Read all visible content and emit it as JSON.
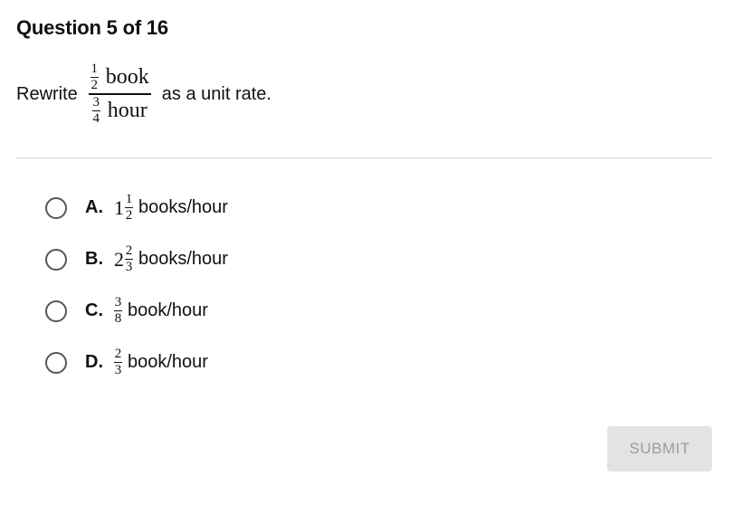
{
  "header": {
    "title": "Question 5 of 16"
  },
  "question": {
    "prefix": "Rewrite",
    "suffix": "as a unit rate.",
    "numerator": {
      "num": "1",
      "den": "2",
      "unit": "book"
    },
    "denominator": {
      "num": "3",
      "den": "4",
      "unit": "hour"
    }
  },
  "options": [
    {
      "letter": "A.",
      "whole": "1",
      "num": "1",
      "den": "2",
      "unit": "books/hour"
    },
    {
      "letter": "B.",
      "whole": "2",
      "num": "2",
      "den": "3",
      "unit": "books/hour"
    },
    {
      "letter": "C.",
      "whole": "",
      "num": "3",
      "den": "8",
      "unit": "book/hour"
    },
    {
      "letter": "D.",
      "whole": "",
      "num": "2",
      "den": "3",
      "unit": "book/hour"
    }
  ],
  "submit": {
    "label": "SUBMIT"
  },
  "colors": {
    "submit_bg": "#e3e3e3",
    "submit_text": "#9c9c9c",
    "divider": "#d6d6d6"
  }
}
